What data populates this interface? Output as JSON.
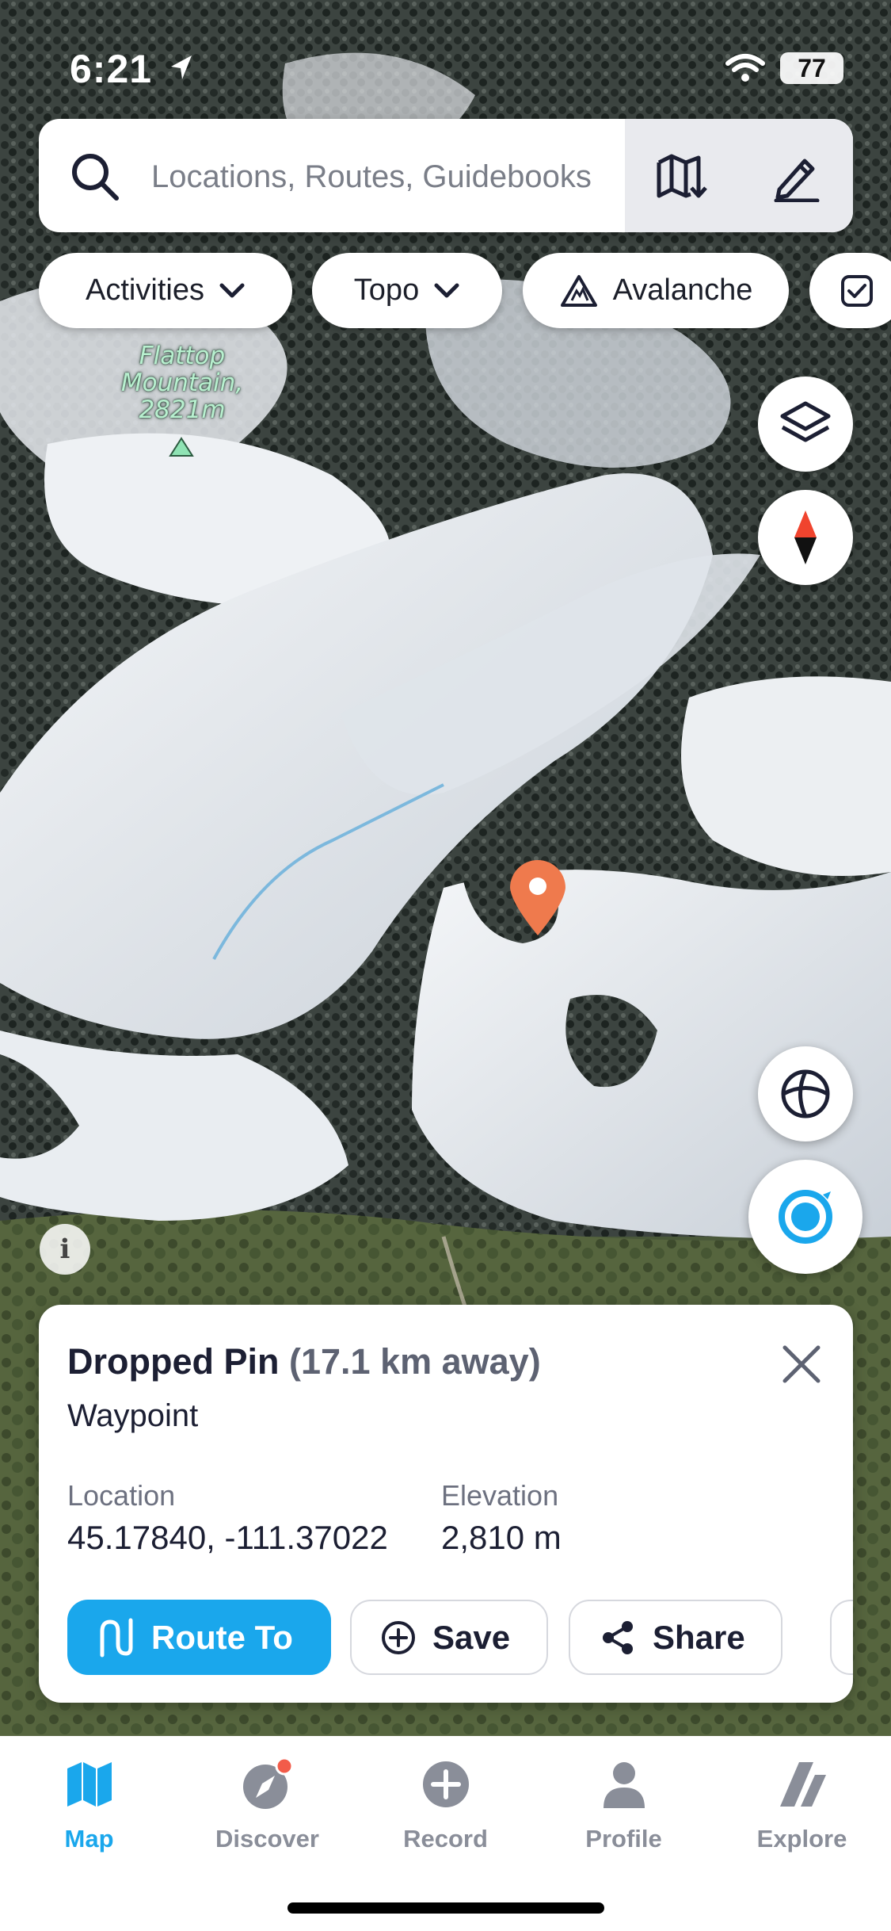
{
  "status_bar": {
    "time": "6:21",
    "battery": "77"
  },
  "search": {
    "placeholder": "Locations, Routes, Guidebooks",
    "icons": [
      "search-icon",
      "map-download-icon",
      "pencil-icon"
    ]
  },
  "filters": [
    {
      "label": "Activities",
      "icon": "chevron-down-icon"
    },
    {
      "label": "Topo",
      "icon": "chevron-down-icon"
    },
    {
      "label": "Avalanche",
      "icon": "avalanche-warning-icon"
    }
  ],
  "map": {
    "peak_label_lines": [
      "Flattop",
      "Mountain,",
      "2821m"
    ],
    "info_badge": "i",
    "map_buttons": [
      "layers-icon",
      "compass-icon",
      "globe-icon",
      "locate-icon"
    ]
  },
  "pin_card": {
    "title": "Dropped Pin",
    "distance": "(17.1 km away)",
    "subtitle": "Waypoint",
    "location_label": "Location",
    "location_value": "45.17840, -111.37022",
    "elevation_label": "Elevation",
    "elevation_value": "2,810 m",
    "actions": [
      {
        "label": "Route To",
        "icon": "route-icon"
      },
      {
        "label": "Save",
        "icon": "plus-circle-icon"
      },
      {
        "label": "Share",
        "icon": "share-icon"
      }
    ]
  },
  "tabs": [
    {
      "label": "Map",
      "icon": "map-icon",
      "active": true
    },
    {
      "label": "Discover",
      "icon": "discover-compass-icon"
    },
    {
      "label": "Record",
      "icon": "record-plus-icon"
    },
    {
      "label": "Profile",
      "icon": "profile-icon"
    },
    {
      "label": "Explore",
      "icon": "explore-icon"
    }
  ],
  "colors": {
    "accent": "#1aa7ec",
    "pin": "#ef7a4d",
    "notification_dot": "#f25c4a"
  }
}
